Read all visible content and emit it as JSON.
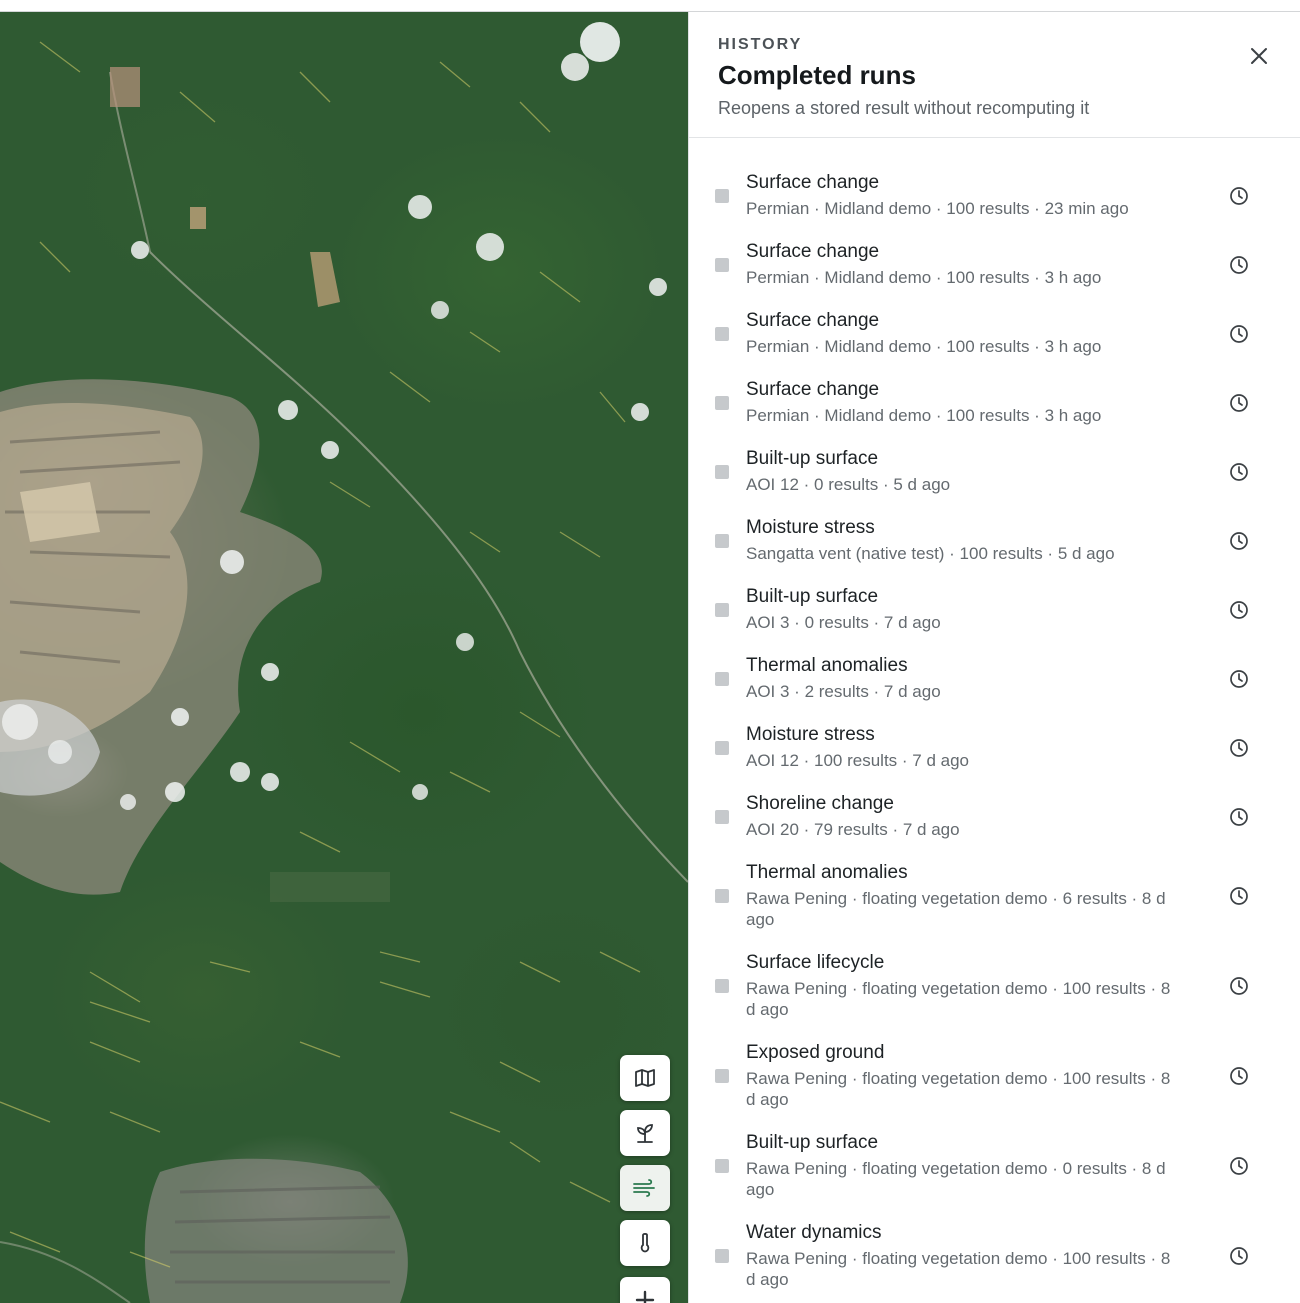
{
  "panel": {
    "eyebrow": "HISTORY",
    "title": "Completed runs",
    "subtitle": "Reopens a stored result without recomputing it",
    "close_icon": "close-icon"
  },
  "map_controls": [
    {
      "name": "map-layers-button",
      "icon": "map-icon"
    },
    {
      "name": "vegetation-button",
      "icon": "sprout-icon"
    },
    {
      "name": "wind-button",
      "icon": "wind-icon",
      "active": true
    },
    {
      "name": "temperature-button",
      "icon": "thermometer-icon"
    },
    {
      "name": "zoom-in-button",
      "icon": "plus-icon"
    }
  ],
  "runs": [
    {
      "name": "Surface change",
      "meta": "Permian · Midland demo · 100 results · 23 min ago"
    },
    {
      "name": "Surface change",
      "meta": "Permian · Midland demo · 100 results · 3 h ago"
    },
    {
      "name": "Surface change",
      "meta": "Permian · Midland demo · 100 results · 3 h ago"
    },
    {
      "name": "Surface change",
      "meta": "Permian · Midland demo · 100 results · 3 h ago"
    },
    {
      "name": "Built-up surface",
      "meta": "AOI 12 · 0 results · 5 d ago"
    },
    {
      "name": "Moisture stress",
      "meta": "Sangatta vent (native test) · 100 results · 5 d ago"
    },
    {
      "name": "Built-up surface",
      "meta": "AOI 3 · 0 results · 7 d ago"
    },
    {
      "name": "Thermal anomalies",
      "meta": "AOI 3 · 2 results · 7 d ago"
    },
    {
      "name": "Moisture stress",
      "meta": "AOI 12 · 100 results · 7 d ago"
    },
    {
      "name": "Shoreline change",
      "meta": "AOI 20 · 79 results · 7 d ago"
    },
    {
      "name": "Thermal anomalies",
      "meta": "Rawa Pening · floating vegetation demo · 6 results · 8 d ago"
    },
    {
      "name": "Surface lifecycle",
      "meta": "Rawa Pening · floating vegetation demo · 100 results · 8 d ago"
    },
    {
      "name": "Exposed ground",
      "meta": "Rawa Pening · floating vegetation demo · 100 results · 8 d ago"
    },
    {
      "name": "Built-up surface",
      "meta": "Rawa Pening · floating vegetation demo · 0 results · 8 d ago"
    },
    {
      "name": "Water dynamics",
      "meta": "Rawa Pening · floating vegetation demo · 100 results · 8 d ago"
    }
  ],
  "colors": {
    "accent": "#2a7a4f",
    "text": "#1d2225",
    "muted": "#646a6f"
  }
}
